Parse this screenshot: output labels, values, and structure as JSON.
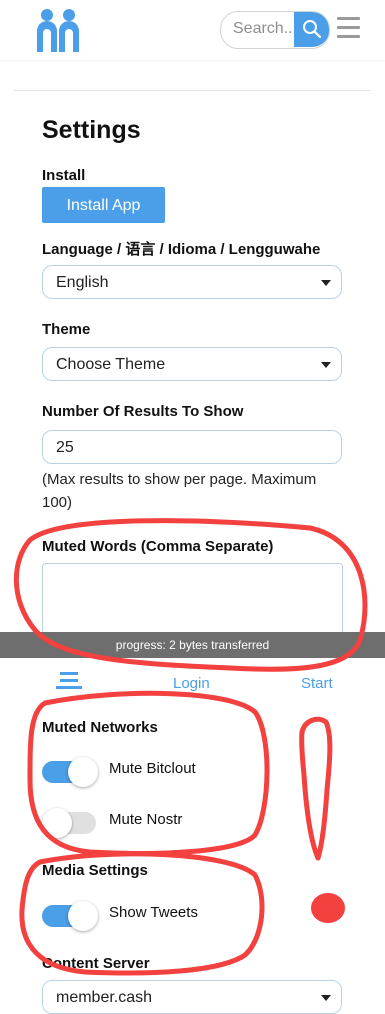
{
  "header": {
    "logo": "people-logo",
    "search": {
      "placeholder": "Search..."
    },
    "search_button_icon": "search-icon",
    "menu_icon": "hamburger-menu-icon"
  },
  "settings": {
    "title": "Settings",
    "install": {
      "label": "Install",
      "button": "Install App"
    },
    "language": {
      "label": "Language / 语言 / Idioma / Lengguwahe",
      "selected": "English"
    },
    "theme": {
      "label": "Theme",
      "selected": "Choose Theme"
    },
    "results": {
      "label": "Number Of Results To Show",
      "value": "25",
      "hint": "(Max results to show per page. Maximum 100)"
    },
    "muted_words": {
      "label": "Muted Words (Comma Separate)",
      "value": ""
    },
    "muted_networks": {
      "label": "Muted Networks",
      "items": [
        {
          "label": "Mute Bitclout",
          "on": true
        },
        {
          "label": "Mute Nostr",
          "on": false
        }
      ]
    },
    "media": {
      "label": "Media Settings",
      "items": [
        {
          "label": "Show Tweets",
          "on": true
        }
      ]
    },
    "content_server": {
      "label": "Content Server",
      "selected": "member.cash"
    }
  },
  "overlay": {
    "progress_text": "progress: 2 bytes transferred",
    "links": {
      "login": "Login",
      "start": "Start"
    },
    "footer_icon": "feed-icon"
  },
  "colors": {
    "accent": "#4a9fe8",
    "annotation": "#f2413f",
    "progress_bg": "#6e6e6e"
  }
}
